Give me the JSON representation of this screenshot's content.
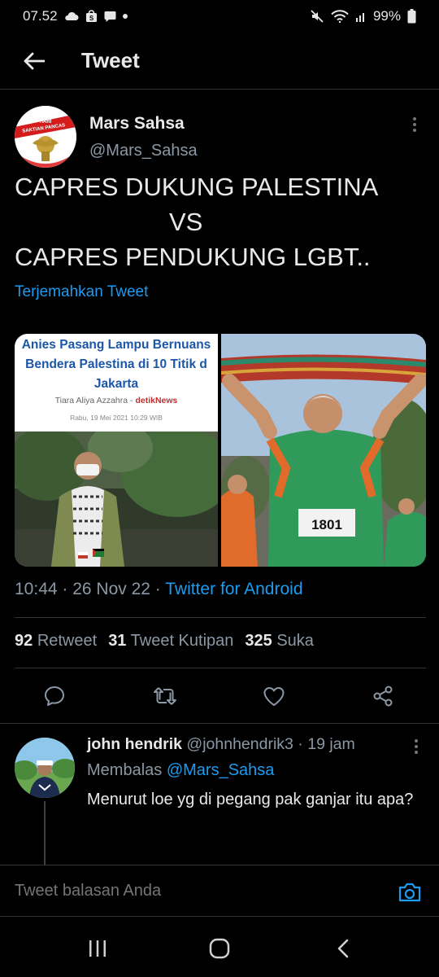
{
  "status_bar": {
    "time": "07.52",
    "battery": "99%"
  },
  "header": {
    "title": "Tweet"
  },
  "tweet": {
    "author_name": "Mars Sahsa",
    "author_handle": "@Mars_Sahsa",
    "text_lines": [
      "CAPRES DUKUNG PALESTINA",
      "VS",
      "CAPRES PENDUKUNG LGBT.."
    ],
    "translate_label": "Terjemahkan Tweet",
    "avatar_text_1": "HARI",
    "avatar_text_2": "SAKTIAN PANCAS",
    "media": {
      "left": {
        "headline_lines": [
          "Anies Pasang Lampu Bernuans",
          "Bendera Palestina di 10 Titik d",
          "Jakarta"
        ],
        "author": "Tiara Aliya Azzahra",
        "separator": " - ",
        "source": "detikNews",
        "date": "Rabu, 19 Mei 2021 10:29 WIB"
      },
      "right": {
        "bib_number": "1801"
      }
    },
    "time": "10:44",
    "date": "26 Nov 22",
    "client": "Twitter for Android",
    "sep": " · ",
    "stats": {
      "retweets": "92",
      "retweets_label": "Retweet",
      "quotes": "31",
      "quotes_label": "Tweet Kutipan",
      "likes": "325",
      "likes_label": "Suka"
    }
  },
  "reply": {
    "name": "john hendrik",
    "handle": "@johnhendrik3",
    "sep": " · ",
    "time": "19 jam",
    "replying_label": "Membalas",
    "replying_to": "@Mars_Sahsa",
    "text": "Menurut loe yg di pegang pak ganjar itu apa?"
  },
  "compose": {
    "placeholder": "Tweet balasan Anda"
  },
  "icons": {
    "back": "arrow-left-icon",
    "more": "more-vertical-icon",
    "reply": "comment-icon",
    "retweet": "retweet-icon",
    "like": "heart-icon",
    "share": "share-icon",
    "camera": "camera-icon",
    "recents": "recents-icon",
    "home": "home-icon",
    "nav_back": "chevron-left-icon"
  },
  "colors": {
    "accent": "#1d9bf0",
    "background": "#000000",
    "secondary_text": "#8b98a5"
  }
}
